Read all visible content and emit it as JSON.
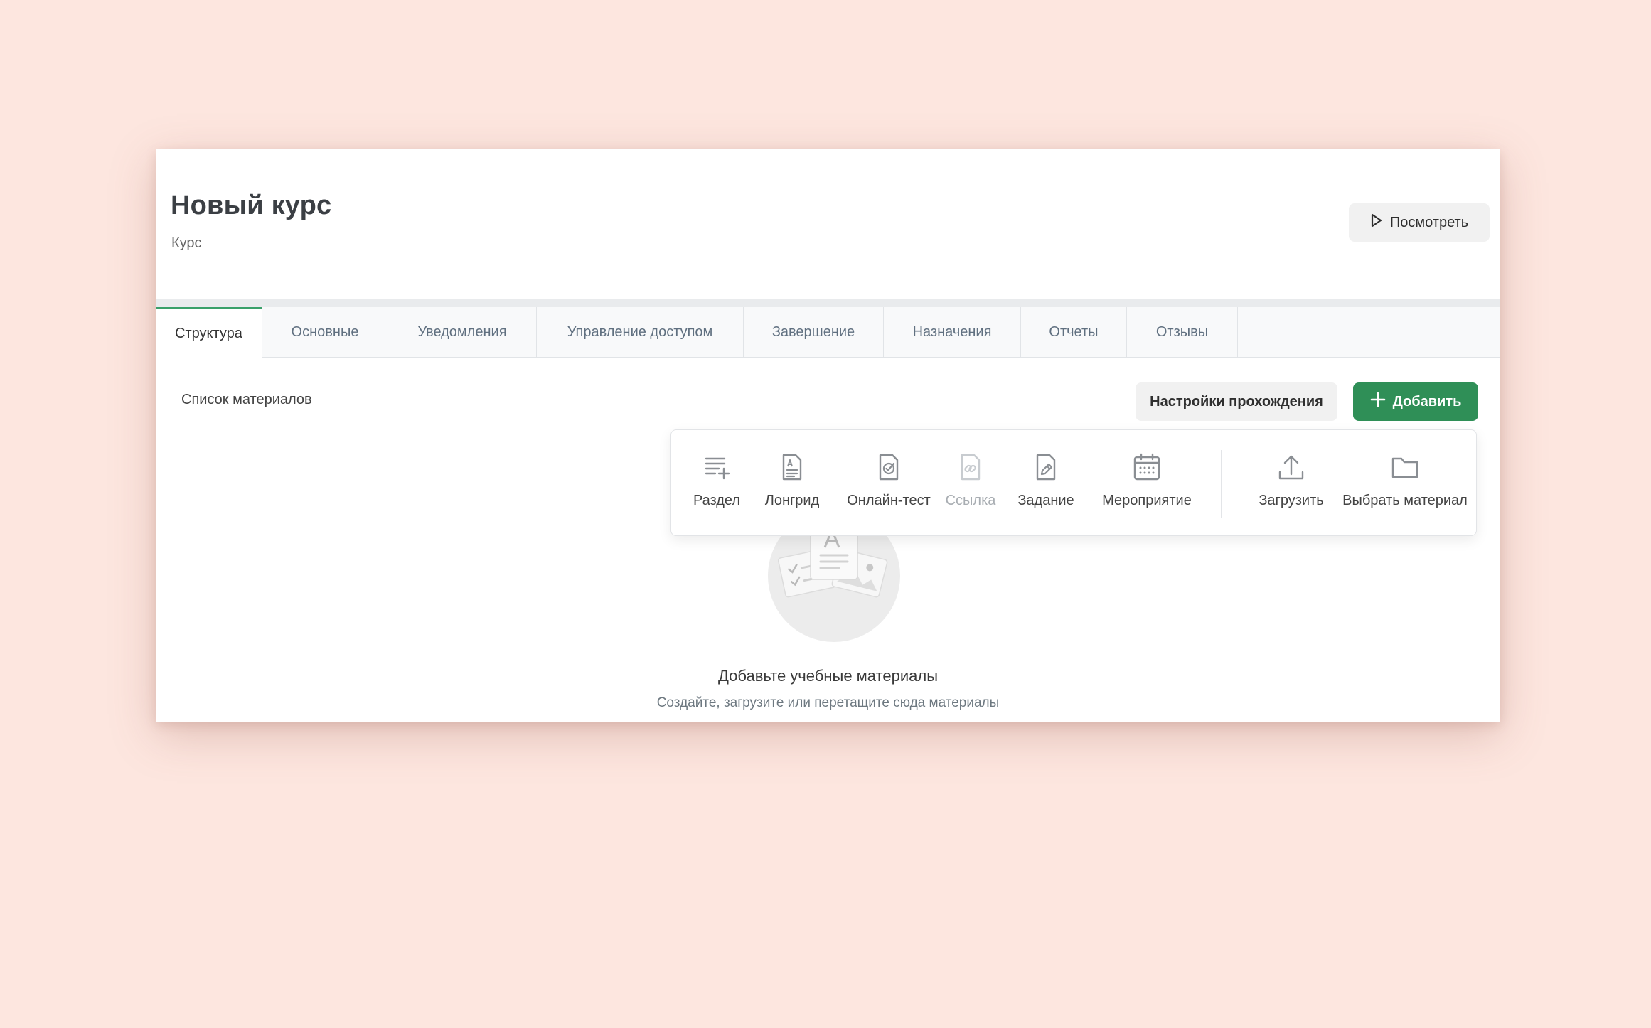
{
  "header": {
    "title": "Новый курс",
    "subtitle": "Курс",
    "preview_label": "Посмотреть"
  },
  "tabs": [
    {
      "label": "Структура",
      "active": true
    },
    {
      "label": "Основные",
      "active": false
    },
    {
      "label": "Уведомления",
      "active": false
    },
    {
      "label": "Управление доступом",
      "active": false
    },
    {
      "label": "Завершение",
      "active": false
    },
    {
      "label": "Назначения",
      "active": false
    },
    {
      "label": "Отчеты",
      "active": false
    },
    {
      "label": "Отзывы",
      "active": false
    }
  ],
  "toolbar": {
    "section_label": "Список материалов",
    "settings_label": "Настройки прохождения",
    "add_label": "Добавить"
  },
  "add_menu": {
    "items": [
      {
        "label": "Раздел",
        "icon": "section-add-icon",
        "enabled": true
      },
      {
        "label": "Лонгрид",
        "icon": "longread-document-icon",
        "enabled": true
      },
      {
        "label": "Онлайн-тест",
        "icon": "online-test-icon",
        "enabled": true
      },
      {
        "label": "Ссылка",
        "icon": "link-document-icon",
        "enabled": false
      },
      {
        "label": "Задание",
        "icon": "task-pencil-icon",
        "enabled": true
      },
      {
        "label": "Мероприятие",
        "icon": "calendar-icon",
        "enabled": true
      },
      {
        "label": "Загрузить",
        "icon": "upload-icon",
        "enabled": true
      },
      {
        "label": "Выбрать материал",
        "icon": "folder-icon",
        "enabled": true
      }
    ]
  },
  "empty_state": {
    "title": "Добавьте учебные материалы",
    "subtitle": "Создайте, загрузите или перетащите сюда материалы",
    "illustration": "materials-illustration"
  },
  "colors": {
    "page_background": "#fde6df",
    "accent_green": "#2f8f57",
    "tab_active_border": "#3aa06a",
    "icon_gray": "#8a8e93",
    "disabled_gray": "#c8ccd0"
  }
}
